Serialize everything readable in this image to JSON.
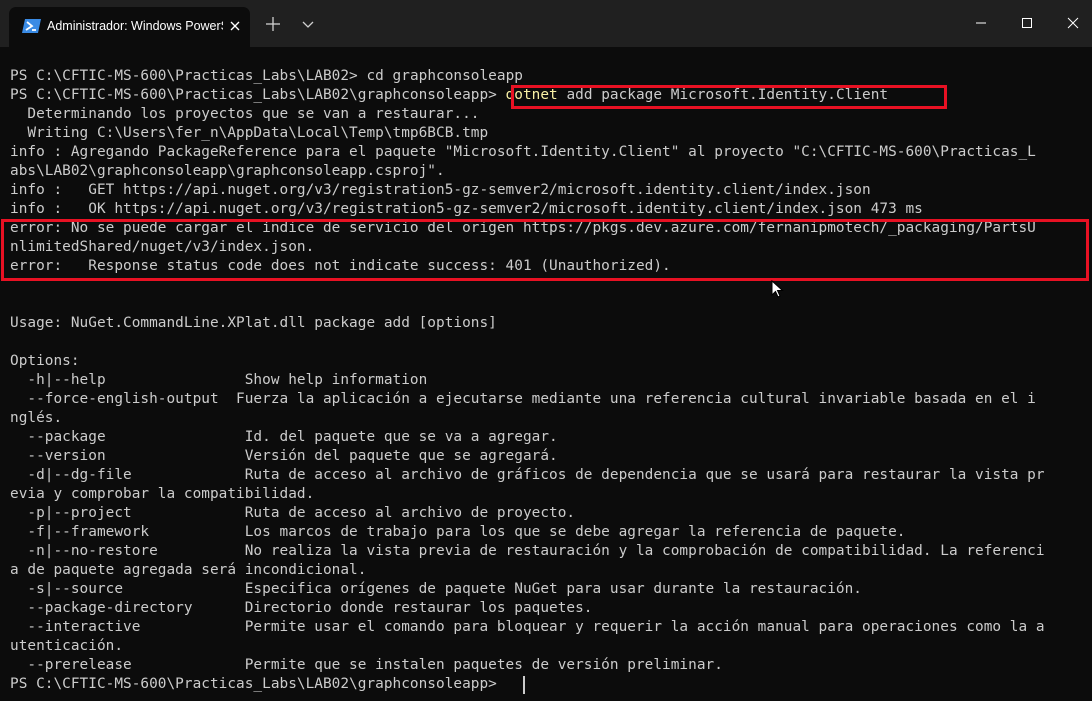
{
  "window": {
    "tab_title": "Administrador: Windows PowerShell",
    "icons": {
      "tab": "powershell-icon",
      "close_tab": "close-icon",
      "new_tab": "plus-icon",
      "dropdown": "chevron-down-icon",
      "minimize": "minimize-icon",
      "maximize": "maximize-icon",
      "close_window": "close-icon"
    }
  },
  "colors": {
    "background": "#0c0c0c",
    "titlebar": "#202020",
    "text": "#cccccc",
    "highlight": "#e81123"
  },
  "terminal": {
    "prompt": "PS C:\\CFTIC-MS-600\\Practicas_Labs\\LAB02>",
    "prompt_app": "PS C:\\CFTIC-MS-600\\Practicas_Labs\\LAB02\\graphconsoleapp>",
    "cmd1": "cd graphconsoleapp",
    "cmd2_keyword": "dotnet",
    "cmd2_rest": "add package Microsoft.Identity.Client",
    "lines": [
      "  Determinando los proyectos que se van a restaurar...",
      "  Writing C:\\Users\\fer_n\\AppData\\Local\\Temp\\tmp6BCB.tmp",
      "info : Agregando PackageReference para el paquete \"Microsoft.Identity.Client\" al proyecto \"C:\\CFTIC-MS-600\\Practicas_L",
      "abs\\LAB02\\graphconsoleapp\\graphconsoleapp.csproj\".",
      "info :   GET https://api.nuget.org/v3/registration5-gz-semver2/microsoft.identity.client/index.json",
      "info :   OK https://api.nuget.org/v3/registration5-gz-semver2/microsoft.identity.client/index.json 473 ms",
      "error: No se puede cargar el índice de servicio del origen https://pkgs.dev.azure.com/fernanipmotech/_packaging/PartsU",
      "nlimitedShared/nuget/v3/index.json.",
      "error:   Response status code does not indicate success: 401 (Unauthorized).",
      "",
      "",
      "Usage: NuGet.CommandLine.XPlat.dll package add [options]",
      "",
      "Options:",
      "  -h|--help                Show help information",
      "  --force-english-output  Fuerza la aplicación a ejecutarse mediante una referencia cultural invariable basada en el i",
      "nglés.",
      "  --package                Id. del paquete que se va a agregar.",
      "  --version                Versión del paquete que se agregará.",
      "  -d|--dg-file             Ruta de acceso al archivo de gráficos de dependencia que se usará para restaurar la vista pr",
      "evia y comprobar la compatibilidad.",
      "  -p|--project             Ruta de acceso al archivo de proyecto.",
      "  -f|--framework           Los marcos de trabajo para los que se debe agregar la referencia de paquete.",
      "  -n|--no-restore          No realiza la vista previa de restauración y la comprobación de compatibilidad. La referenci",
      "a de paquete agregada será incondicional.",
      "  -s|--source              Especifica orígenes de paquete NuGet para usar durante la restauración.",
      "  --package-directory      Directorio donde restaurar los paquetes.",
      "  --interactive            Permite usar el comando para bloquear y requerir la acción manual para operaciones como la a",
      "utenticación.",
      "  --prerelease             Permite que se instalen paquetes de versión preliminar."
    ]
  }
}
